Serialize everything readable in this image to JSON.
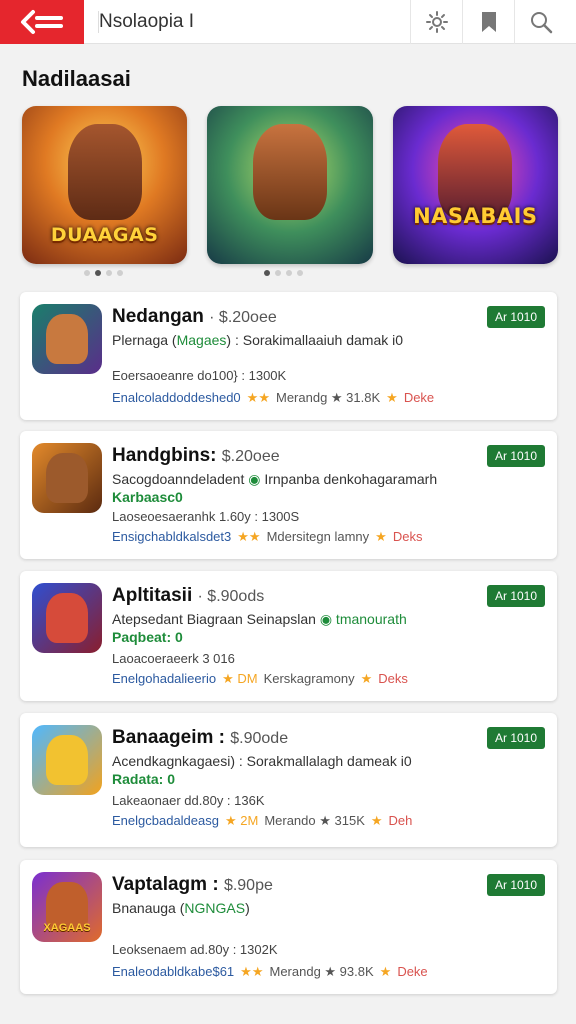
{
  "header": {
    "title": "Nsolaopia I",
    "icons": [
      "back-arrow-icon",
      "settings-icon",
      "bookmark-icon",
      "search-icon"
    ]
  },
  "featured": {
    "title": "Nadilaasai",
    "cards": [
      {
        "logo": "DUAAGAS"
      },
      {
        "logo": ""
      },
      {
        "logo": "NASABAIS"
      }
    ],
    "dots_left": [
      "",
      "",
      "",
      ""
    ],
    "dots_right": [
      "",
      "",
      "",
      ""
    ]
  },
  "apps": [
    {
      "name": "Nedangan",
      "price": "·  $.20oee",
      "desc_plain": "Plernaga (",
      "desc_green": "Magaes",
      "desc_rest": ") : Sorakimallaaiuh damak i0",
      "sub": "",
      "meta": "Eoersaoeanre do100} : 1300K",
      "stats_link": "Enalcoladdoddeshed0",
      "stats_stars": "★★",
      "stats_grey": "Merandg ★ 31.8K",
      "stats_end": "Deke",
      "badge": "Ar 1010"
    },
    {
      "name": "Handgbins:",
      "price": "$.20oee",
      "desc_plain": "Sacogdoanndeladent ",
      "desc_green": "◉",
      "desc_rest": " Irnpanba denkohagaramarh",
      "sub": "Karbaasc0",
      "meta": "Laoseoesaeranhk 1.60y : 1300S",
      "stats_link": "Ensigchabldkalsdet3",
      "stats_stars": "★★",
      "stats_grey": "Mdersitegn lamny",
      "stats_end": "Deks",
      "badge": "Ar 1010"
    },
    {
      "name": "Apltitasii",
      "price": "·  $.90ods",
      "desc_plain": "Atepsedant Biagraan Seinapslan ",
      "desc_green": "◉ tmanourath",
      "desc_rest": "",
      "sub": "Paqbeat: 0",
      "meta": "Laoacoeraeerk 3 016",
      "stats_link": "Enelgohadalieerio",
      "stats_stars": "★ DM",
      "stats_grey": "Kerskagramony",
      "stats_end": "Deks",
      "badge": "Ar 1010"
    },
    {
      "name": "Banaageim :",
      "price": "$.90ode",
      "desc_plain": "Acendkagnkagaesi",
      "desc_green": "",
      "desc_rest": ") : Sorakmallalagh dameak i0",
      "sub": "Radata: 0",
      "meta": "Lakeaonaer dd.80y : 136K",
      "stats_link": "Enelgcbadaldeasg",
      "stats_stars": "★ 2M",
      "stats_grey": "Merando ★ 315K",
      "stats_end": "Deh",
      "badge": "Ar 1010"
    },
    {
      "name": "Vaptalagm :",
      "price": "$.90pe",
      "desc_plain": "Bnanauga (",
      "desc_green": "NGNGAS",
      "desc_rest": ")",
      "sub": "",
      "meta": "Leoksenaem ad.80y : 1302K",
      "stats_link": "Enaleodabldkabe$61",
      "stats_stars": "★★",
      "stats_grey": "Merandg ★ 93.8K",
      "stats_end": "Deke",
      "badge": "Ar 1010"
    }
  ],
  "icon_labels": [
    "",
    "",
    "",
    "",
    "XAGAAS"
  ],
  "colors": {
    "accent": "#e5262d",
    "badge": "#1f7a34",
    "green_text": "#1e8c3a",
    "link": "#2c5aa0",
    "star": "#f5a623"
  }
}
